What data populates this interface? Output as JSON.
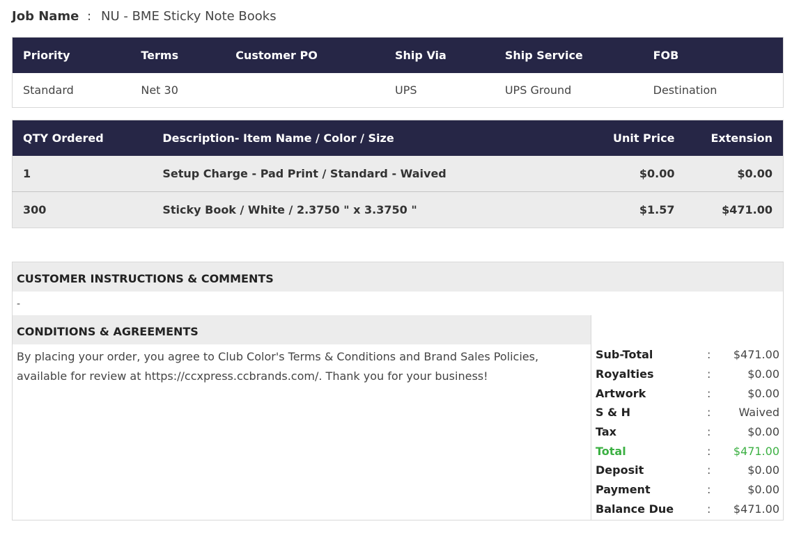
{
  "job": {
    "label": "Job Name",
    "colon": ":",
    "value": "NU - BME Sticky Note Books"
  },
  "order_info": {
    "headers": [
      "Priority",
      "Terms",
      "Customer PO",
      "Ship Via",
      "Ship Service",
      "FOB"
    ],
    "values": [
      "Standard",
      "Net 30",
      "",
      "UPS",
      "UPS Ground",
      "Destination"
    ]
  },
  "items": {
    "headers": [
      "QTY Ordered",
      "Description- Item Name / Color / Size",
      "Unit Price",
      "Extension"
    ],
    "rows": [
      [
        "1",
        "Setup Charge - Pad Print / Standard - Waived",
        "$0.00",
        "$0.00"
      ],
      [
        "300",
        "Sticky Book / White / 2.3750 \" x 3.3750 \"",
        "$1.57",
        "$471.00"
      ]
    ]
  },
  "customer_instructions": {
    "title": "CUSTOMER INSTRUCTIONS & COMMENTS",
    "text": "-"
  },
  "conditions": {
    "title": "CONDITIONS & AGREEMENTS",
    "text": "By placing your order, you agree to Club Color's Terms & Conditions and Brand Sales Policies, available for review at https://ccxpress.ccbrands.com/. Thank you for your business!"
  },
  "totals": [
    {
      "label": "Sub-Total",
      "colon": ":",
      "value": "$471.00"
    },
    {
      "label": "Royalties",
      "colon": ":",
      "value": "$0.00"
    },
    {
      "label": "Artwork",
      "colon": ":",
      "value": "$0.00"
    },
    {
      "label": "S & H",
      "colon": ":",
      "value": "Waived"
    },
    {
      "label": "Tax",
      "colon": ":",
      "value": "$0.00"
    },
    {
      "label": "Total",
      "colon": ":",
      "value": "$471.00"
    },
    {
      "label": "Deposit",
      "colon": ":",
      "value": "$0.00"
    },
    {
      "label": "Payment",
      "colon": ":",
      "value": "$0.00"
    },
    {
      "label": "Balance Due",
      "colon": ":",
      "value": "$471.00"
    }
  ],
  "colors": {
    "header_bg": "#262646",
    "row_bg": "#ececec",
    "total_green": "#3cb043"
  }
}
